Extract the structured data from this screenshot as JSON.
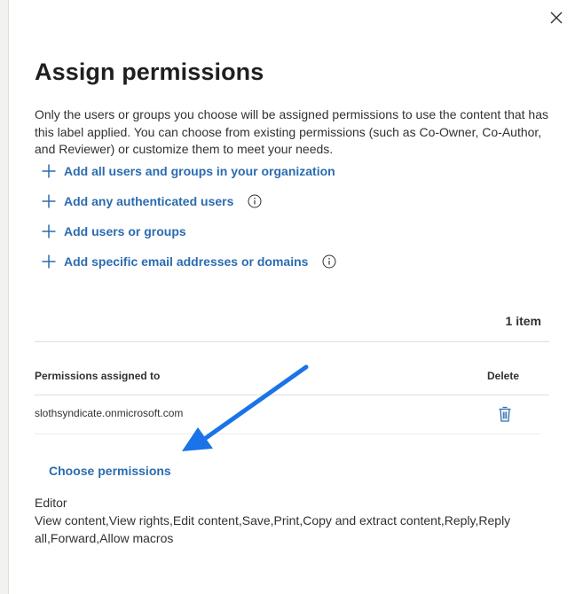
{
  "panel": {
    "title": "Assign permissions",
    "description": "Only the users or groups you choose will be assigned permissions to use the content that has this label applied. You can choose from existing permissions (such as Co-Owner, Co-Author, and Reviewer) or customize them to meet your needs.",
    "close_icon": "close-icon"
  },
  "actions": [
    {
      "label": "Add all users and groups in your organization",
      "icon": "plus-icon",
      "info": false
    },
    {
      "label": "Add any authenticated users",
      "icon": "plus-icon",
      "info": true
    },
    {
      "label": "Add users or groups",
      "icon": "plus-icon",
      "info": false
    },
    {
      "label": "Add specific email addresses or domains",
      "icon": "plus-icon",
      "info": true
    }
  ],
  "table": {
    "count": "1 item",
    "columns": [
      "Permissions assigned to",
      "Delete"
    ],
    "rows": [
      {
        "assigned_to": "slothsyndicate.onmicrosoft.com",
        "delete_icon": "trash-icon"
      }
    ]
  },
  "permissions": {
    "choose_label": "Choose permissions",
    "role": "Editor",
    "rights": "View content,View rights,Edit content,Save,Print,Copy and extract content,Reply,Reply all,Forward,Allow macros"
  },
  "colors": {
    "link": "#2b6cb0",
    "text": "#323130",
    "annotation_arrow": "#1a73e8"
  }
}
